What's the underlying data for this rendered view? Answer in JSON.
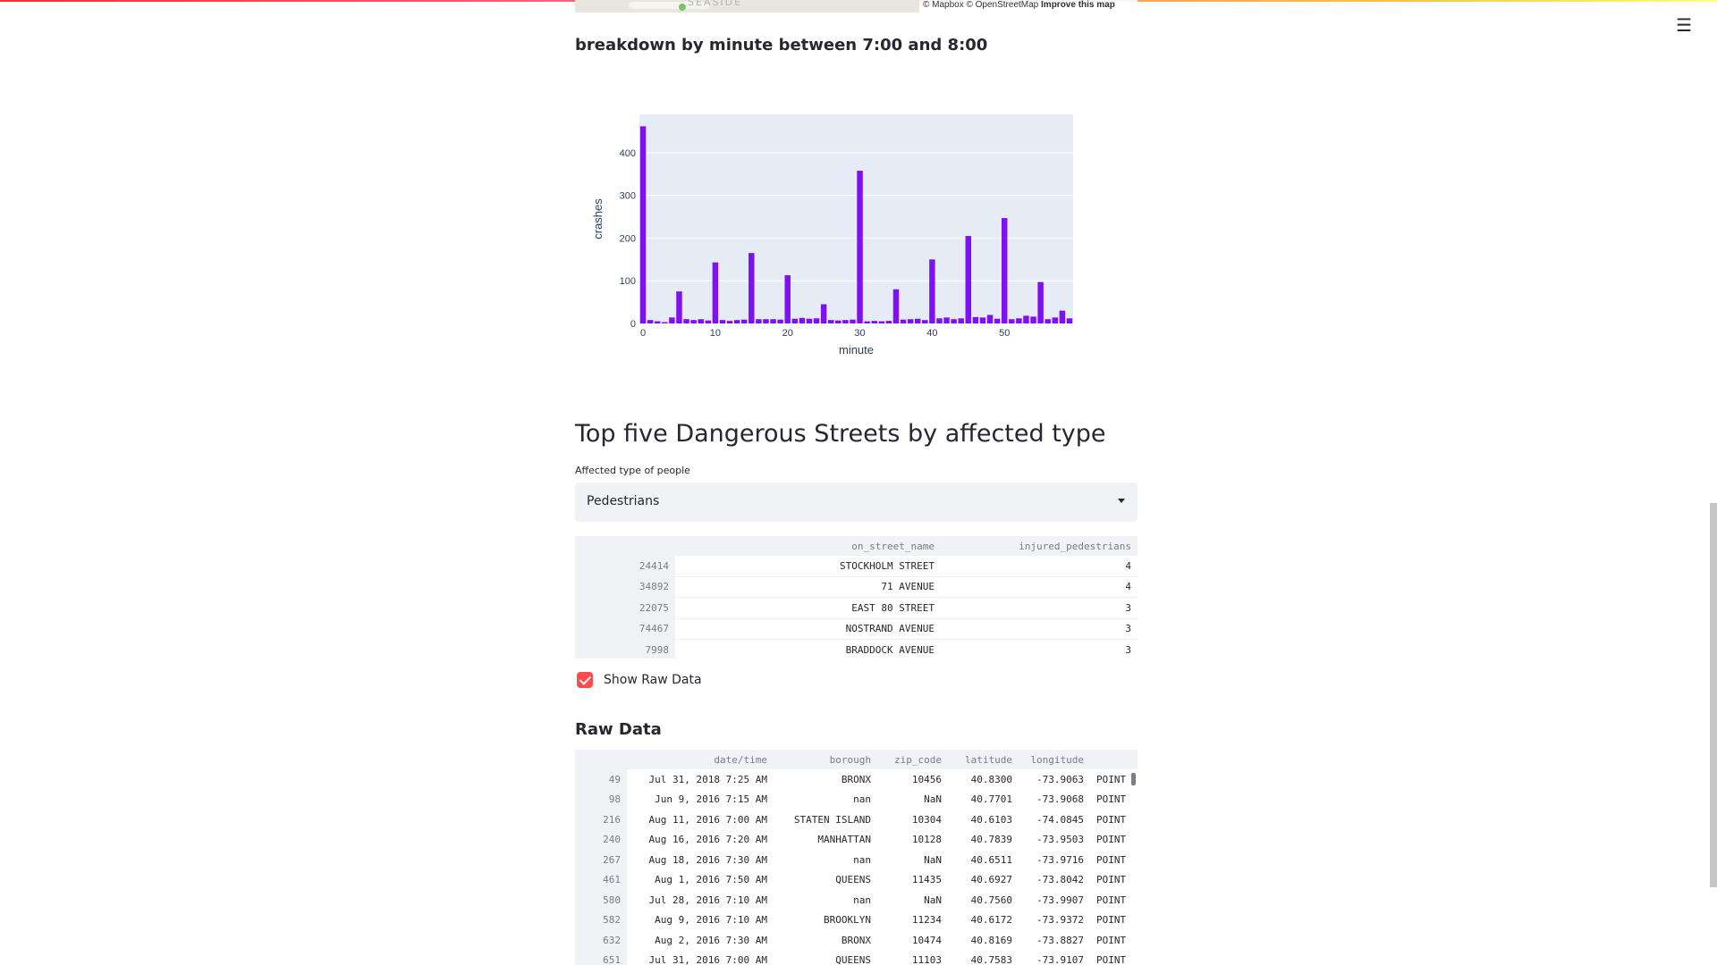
{
  "map": {
    "label": "SEASIDE",
    "attribution": "© Mapbox © OpenStreetMap",
    "improve_link": "Improve this map"
  },
  "chart_section": {
    "title": "breakdown by minute between 7:00 and 8:00"
  },
  "chart_data": {
    "type": "bar",
    "xlabel": "minute",
    "ylabel": "crashes",
    "x": [
      0,
      1,
      2,
      3,
      4,
      5,
      6,
      7,
      8,
      9,
      10,
      11,
      12,
      13,
      14,
      15,
      16,
      17,
      18,
      19,
      20,
      21,
      22,
      23,
      24,
      25,
      26,
      27,
      28,
      29,
      30,
      31,
      32,
      33,
      34,
      35,
      36,
      37,
      38,
      39,
      40,
      41,
      42,
      43,
      44,
      45,
      46,
      47,
      48,
      49,
      50,
      51,
      52,
      53,
      54,
      55,
      56,
      57,
      58,
      59
    ],
    "values": [
      462,
      8,
      5,
      3,
      14,
      75,
      10,
      8,
      10,
      7,
      143,
      8,
      6,
      8,
      9,
      165,
      10,
      10,
      10,
      9,
      113,
      11,
      13,
      11,
      12,
      45,
      8,
      7,
      8,
      9,
      358,
      5,
      6,
      5,
      6,
      80,
      9,
      10,
      11,
      8,
      150,
      12,
      14,
      10,
      12,
      205,
      15,
      14,
      20,
      11,
      247,
      10,
      12,
      18,
      16,
      97,
      10,
      14,
      30,
      12
    ],
    "xticks": [
      0,
      10,
      20,
      30,
      40,
      50
    ],
    "yticks": [
      0,
      100,
      200,
      300,
      400
    ],
    "xlim": [
      -0.5,
      59.5
    ],
    "ylim": [
      0,
      490
    ],
    "bar_color": "#7f10f2",
    "plot_bg": "#e5ecf6",
    "grid": true
  },
  "streets_section": {
    "title": "Top five Dangerous Streets by affected type",
    "select_label": "Affected type of people",
    "select_value": "Pedestrians"
  },
  "streets_table": {
    "columns": [
      "on_street_name",
      "injured_pedestrians"
    ],
    "rows": [
      {
        "index": "24414",
        "on_street_name": "STOCKHOLM STREET",
        "injured_pedestrians": "4"
      },
      {
        "index": "34892",
        "on_street_name": "71 AVENUE",
        "injured_pedestrians": "4"
      },
      {
        "index": "22075",
        "on_street_name": "EAST 80 STREET",
        "injured_pedestrians": "3"
      },
      {
        "index": "74467",
        "on_street_name": "NOSTRAND AVENUE",
        "injured_pedestrians": "3"
      },
      {
        "index": "7998",
        "on_street_name": "BRADDOCK AVENUE",
        "injured_pedestrians": "3"
      }
    ]
  },
  "raw_data_checkbox": {
    "label": "Show Raw Data",
    "checked": true
  },
  "raw_section": {
    "title": "Raw Data"
  },
  "raw_table": {
    "columns": [
      "date/time",
      "borough",
      "zip_code",
      "latitude",
      "longitude",
      ""
    ],
    "rows": [
      {
        "index": "49",
        "datetime": "Jul 31, 2018 7:25 AM",
        "borough": "BRONX",
        "zip_code": "10456",
        "latitude": "40.8300",
        "longitude": "-73.9063",
        "location": "POINT"
      },
      {
        "index": "98",
        "datetime": "Jun 9, 2016 7:15 AM",
        "borough": "nan",
        "zip_code": "NaN",
        "latitude": "40.7701",
        "longitude": "-73.9068",
        "location": "POINT"
      },
      {
        "index": "216",
        "datetime": "Aug 11, 2016 7:00 AM",
        "borough": "STATEN ISLAND",
        "zip_code": "10304",
        "latitude": "40.6103",
        "longitude": "-74.0845",
        "location": "POINT"
      },
      {
        "index": "240",
        "datetime": "Aug 16, 2016 7:20 AM",
        "borough": "MANHATTAN",
        "zip_code": "10128",
        "latitude": "40.7839",
        "longitude": "-73.9503",
        "location": "POINT"
      },
      {
        "index": "267",
        "datetime": "Aug 18, 2016 7:30 AM",
        "borough": "nan",
        "zip_code": "NaN",
        "latitude": "40.6511",
        "longitude": "-73.9716",
        "location": "POINT"
      },
      {
        "index": "461",
        "datetime": "Aug 1, 2016 7:50 AM",
        "borough": "QUEENS",
        "zip_code": "11435",
        "latitude": "40.6927",
        "longitude": "-73.8042",
        "location": "POINT"
      },
      {
        "index": "580",
        "datetime": "Jul 28, 2016 7:10 AM",
        "borough": "nan",
        "zip_code": "NaN",
        "latitude": "40.7560",
        "longitude": "-73.9907",
        "location": "POINT"
      },
      {
        "index": "582",
        "datetime": "Aug 9, 2016 7:10 AM",
        "borough": "BROOKLYN",
        "zip_code": "11234",
        "latitude": "40.6172",
        "longitude": "-73.9372",
        "location": "POINT"
      },
      {
        "index": "632",
        "datetime": "Aug 2, 2016 7:30 AM",
        "borough": "BRONX",
        "zip_code": "10474",
        "latitude": "40.8169",
        "longitude": "-73.8827",
        "location": "POINT"
      },
      {
        "index": "651",
        "datetime": "Jul 31, 2016 7:00 AM",
        "borough": "QUEENS",
        "zip_code": "11103",
        "latitude": "40.7583",
        "longitude": "-73.9107",
        "location": "POINT"
      }
    ]
  },
  "menu": {
    "icon": "hamburger-menu-icon",
    "glyph": "☰"
  }
}
